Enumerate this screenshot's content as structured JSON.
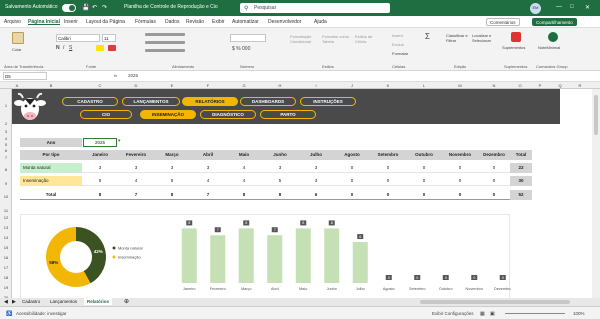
{
  "titlebar": {
    "autosave_label": "Salvamento Automático",
    "doc_title": "Planilha de Controle de Reprodução e Cio",
    "search_placeholder": "Pesquisar",
    "user_initials": "EM"
  },
  "menu": [
    "Arquivo",
    "Página Inicial",
    "Inserir",
    "Layout da Página",
    "Fórmulas",
    "Dados",
    "Revisão",
    "Exibir",
    "Automatizar",
    "Desenvolvedor",
    "Ajuda"
  ],
  "menu_buttons": {
    "comments": "Comentários",
    "share": "Compartilhamento"
  },
  "ribbon": {
    "paste": "Colar",
    "font_name": "Calibri",
    "font_size": "11",
    "groups": [
      "Área de Transferência",
      "Fonte",
      "Alinhamento",
      "Número",
      "Estilos",
      "Células",
      "Edição",
      "Suplementos",
      "Comandos Group"
    ],
    "styles": [
      "Formatação Condicional",
      "Formatar como Tabela",
      "Estilos de Célula"
    ],
    "cells": [
      "Inserir",
      "Excluir",
      "Formatar"
    ],
    "editing": [
      "Classificar e Filtrar",
      "Localizar e Selecionar"
    ],
    "addins": "Suplementos",
    "group_cmd": "NoteMinimal"
  },
  "formula_bar": {
    "name_box": "D5",
    "fx": "fx",
    "value": "2025"
  },
  "columns": [
    "A",
    "B",
    "C",
    "D",
    "E",
    "F",
    "G",
    "H",
    "I",
    "J",
    "K",
    "L",
    "M",
    "N",
    "O",
    "P",
    "Q",
    "R"
  ],
  "rows": [
    "1",
    "2",
    "3",
    "4",
    "5",
    "6",
    "7",
    "8",
    "9",
    "10",
    "11",
    "12",
    "13",
    "14",
    "15",
    "16",
    "17",
    "18",
    "19",
    "20"
  ],
  "nav_top": [
    {
      "label": "CADASTRO",
      "active": false
    },
    {
      "label": "LANÇAMENTOS",
      "active": false
    },
    {
      "label": "RELATÓRIOS",
      "active": true
    },
    {
      "label": "DASHBOARDS",
      "active": false
    },
    {
      "label": "INSTRUÇÕES",
      "active": false
    }
  ],
  "nav_sub": [
    {
      "label": "CIO",
      "active": false
    },
    {
      "label": "INSEMINAÇÃO",
      "active": true
    },
    {
      "label": "DIAGNÓSTICO",
      "active": false
    },
    {
      "label": "PARTO",
      "active": false
    }
  ],
  "year": {
    "label": "Ano",
    "value": "2025"
  },
  "table": {
    "corner": "Por tipo",
    "months": [
      "Janeiro",
      "Fevereiro",
      "Março",
      "Abril",
      "Maio",
      "Junho",
      "Julho",
      "Agosto",
      "Setembro",
      "Outubro",
      "Novembro",
      "Dezembro"
    ],
    "total_label": "Total",
    "rows": [
      {
        "label": "Monta natural",
        "values": [
          "3",
          "3",
          "3",
          "3",
          "4",
          "3",
          "3",
          "0",
          "0",
          "0",
          "0",
          "0"
        ],
        "total": "22",
        "color": "#c6efce"
      },
      {
        "label": "Inseminação",
        "values": [
          "5",
          "4",
          "5",
          "4",
          "4",
          "5",
          "3",
          "0",
          "0",
          "0",
          "0",
          "0"
        ],
        "total": "30",
        "color": "#ffe699"
      },
      {
        "label": "Total",
        "values": [
          "8",
          "7",
          "8",
          "7",
          "8",
          "8",
          "6",
          "0",
          "0",
          "0",
          "0",
          "0"
        ],
        "total": "52",
        "color": "#ffffff"
      }
    ]
  },
  "colors": {
    "brand": "#1e6e41",
    "accent": "#f2b705",
    "dark_green": "#3b5323",
    "bar": "#c5e0b4",
    "nav_bg": "#4a4a4a"
  },
  "chart_data": [
    {
      "type": "pie",
      "categories": [
        "Monta natural",
        "Inseminação"
      ],
      "values": [
        42,
        58
      ],
      "value_labels": [
        "42%",
        "58%"
      ],
      "legend": [
        "Monta natural",
        "Inseminação"
      ],
      "colors": [
        "#3b5323",
        "#f2b705"
      ],
      "legend_position": "right"
    },
    {
      "type": "bar",
      "categories": [
        "Janeiro",
        "Fevereiro",
        "Março",
        "Abril",
        "Maio",
        "Junho",
        "Julho",
        "Agosto",
        "Setembro",
        "Outubro",
        "Novembro",
        "Dezembro"
      ],
      "values": [
        8,
        7,
        8,
        7,
        8,
        8,
        6,
        0,
        0,
        0,
        0,
        0
      ],
      "ylim": [
        0,
        8.5
      ],
      "color": "#c5e0b4"
    }
  ],
  "sheets": [
    "Cadastro",
    "Lançamentos",
    "Relatórios"
  ],
  "status": {
    "accessibility": "Acessibilidade: investigar",
    "display": "Exibir Configurações",
    "zoom": "100%"
  }
}
